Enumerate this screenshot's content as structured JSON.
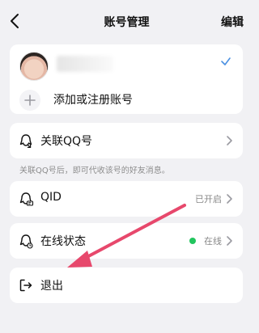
{
  "header": {
    "title": "账号管理",
    "edit_label": "编辑"
  },
  "accounts": {
    "add_label": "添加或注册账号"
  },
  "items": [
    {
      "label": "关联QQ号",
      "value": ""
    },
    {
      "label": "QID",
      "value": "已开启"
    },
    {
      "label": "在线状态",
      "value": "在线"
    },
    {
      "label": "退出",
      "value": ""
    }
  ],
  "note": "关联QQ号后，即可代收该号的好友消息。",
  "colors": {
    "background": "#f1f1f4",
    "card": "#ffffff",
    "online_dot": "#22c55e",
    "check": "#4a90e2",
    "arrow": "#e7486c"
  },
  "icons": {
    "back": "chevron-left-icon",
    "check": "check-icon",
    "add": "plus-icon",
    "link_qq": "qq-link-icon",
    "qid": "qid-icon",
    "online": "online-status-icon",
    "logout": "logout-icon",
    "chevron": "chevron-right-icon"
  }
}
